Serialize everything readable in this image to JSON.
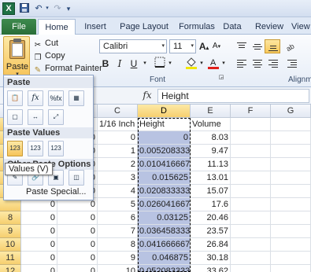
{
  "app": {
    "logo_letter": "X",
    "qat": [
      "save",
      "undo",
      "redo",
      "customize"
    ]
  },
  "tabs": [
    {
      "label": "File"
    },
    {
      "label": "Home"
    },
    {
      "label": "Insert"
    },
    {
      "label": "Page Layout"
    },
    {
      "label": "Formulas"
    },
    {
      "label": "Data"
    },
    {
      "label": "Review"
    },
    {
      "label": "View"
    }
  ],
  "clipboard": {
    "paste_label": "Paste",
    "cut_label": "Cut",
    "copy_label": "Copy",
    "format_painter_label": "Format Painter"
  },
  "font": {
    "name": "Calibri",
    "size": "11",
    "group_label": "Font",
    "bold": "B",
    "italic": "I",
    "underline": "U",
    "grow": "A",
    "shrink": "A"
  },
  "alignment": {
    "group_label": "Alignm"
  },
  "formula_bar": {
    "fx_label": "fx",
    "content": "Height"
  },
  "columns": [
    "C",
    "D",
    "E",
    "F",
    "G"
  ],
  "selected_column": "D",
  "header_row": {
    "C": "1/16 Inch",
    "D": "Height",
    "E": "Volume"
  },
  "rows": [
    {
      "num": "",
      "a": "0",
      "b": "0",
      "c": "0",
      "d": "0",
      "e": "8.03"
    },
    {
      "num": "",
      "a": "0",
      "b": "0",
      "c": "1",
      "d": "0.005208333",
      "e": "9.47"
    },
    {
      "num": "",
      "a": "0",
      "b": "0",
      "c": "2",
      "d": "0.010416667",
      "e": "11.13"
    },
    {
      "num": "",
      "a": "0",
      "b": "0",
      "c": "3",
      "d": "0.015625",
      "e": "13.01"
    },
    {
      "num": "",
      "a": "0",
      "b": "0",
      "c": "4",
      "d": "0.020833333",
      "e": "15.07"
    },
    {
      "num": "",
      "a": "0",
      "b": "0",
      "c": "5",
      "d": "0.026041667",
      "e": "17.6"
    },
    {
      "num": "8",
      "a": "0",
      "b": "0",
      "c": "6",
      "d": "0.03125",
      "e": "20.46"
    },
    {
      "num": "9",
      "a": "0",
      "b": "0",
      "c": "7",
      "d": "0.036458333",
      "e": "23.57"
    },
    {
      "num": "10",
      "a": "0",
      "b": "0",
      "c": "8",
      "d": "0.041666667",
      "e": "26.84"
    },
    {
      "num": "11",
      "a": "0",
      "b": "0",
      "c": "9",
      "d": "0.046875",
      "e": "30.18"
    },
    {
      "num": "12",
      "a": "0",
      "b": "0",
      "c": "10",
      "d": "0.052083333",
      "e": "33.62"
    }
  ],
  "paste_menu": {
    "paste_header": "Paste",
    "values_header": "Paste Values",
    "other_header": "Other Paste Options",
    "paste_special": "Paste Special...",
    "tooltip": "Values (V)",
    "paste_icons": [
      "paste",
      "formulas",
      "formulas-number-formatting",
      "keep-source-formatting",
      "no-borders",
      "keep-column-widths",
      "transpose"
    ],
    "value_icons": [
      {
        "name": "values",
        "glyph": "123"
      },
      {
        "name": "values-number-formatting",
        "glyph": "123"
      },
      {
        "name": "values-source-formatting",
        "glyph": "123"
      }
    ]
  }
}
